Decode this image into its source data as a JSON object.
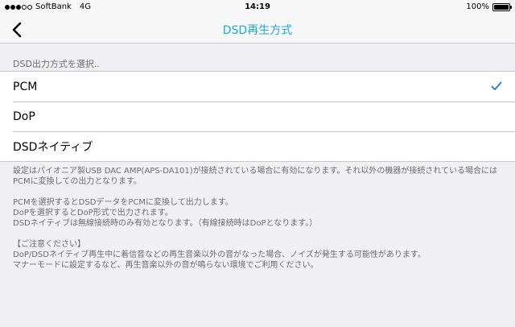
{
  "status_bar": {
    "carrier": "SoftBank",
    "network": "4G",
    "time": "14:19",
    "battery": "100%"
  },
  "nav": {
    "title": "DSD再生方式"
  },
  "section": {
    "header": "DSD出力方式を選択..",
    "options": [
      {
        "label": "PCM",
        "selected": true
      },
      {
        "label": "DoP",
        "selected": false
      },
      {
        "label": "DSDネイティブ",
        "selected": false
      }
    ]
  },
  "footer": {
    "para1": "設定はパイオニア製USB DAC AMP(APS-DA101)が接続されている場合に有効になります。それ以外の機器が接続されている場合にはPCMに変換しての出力となります。",
    "para2": [
      "PCMを選択するとDSDデータをPCMに変換して出力します。",
      "DoPを選択するとDoP形式で出力されます。",
      "DSDネイティブは無線接続時のみ有効となります。（有線接続時はDoPとなります。）"
    ],
    "para3": [
      "【ご注意ください】",
      "DoP/DSDネイティブ再生中に着信音などの再生音楽以外の音がなった場合、ノイズが発生する可能性があります。",
      "マナーモードに設定するなど、再生音楽以外の音が鳴らない環境でご利用ください。"
    ]
  },
  "colors": {
    "accent": "#1fa8d6",
    "check": "#1a7ce0",
    "background": "#efeff4"
  }
}
